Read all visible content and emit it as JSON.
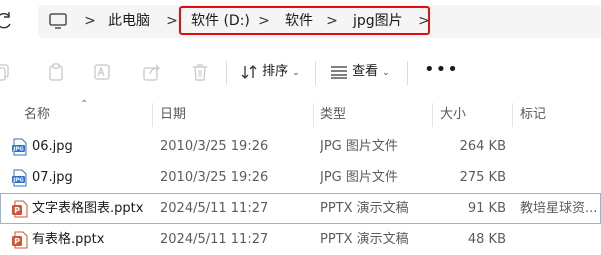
{
  "address_bar": {
    "crumbs": [
      "此电脑",
      "软件 (D:)",
      "软件",
      "jpg图片"
    ],
    "separator": ">"
  },
  "toolbar": {
    "sort_label": "排序",
    "view_label": "查看",
    "more_label": "•••"
  },
  "columns": {
    "name": "名称",
    "date": "日期",
    "type": "类型",
    "size": "大小",
    "tags": "标记"
  },
  "files": [
    {
      "name": "06.jpg",
      "date": "2010/3/25 19:26",
      "type": "JPG 图片文件",
      "size": "264 KB",
      "tags": "",
      "icon": "jpg-file-icon"
    },
    {
      "name": "07.jpg",
      "date": "2010/3/25 19:26",
      "type": "JPG 图片文件",
      "size": "275 KB",
      "tags": "",
      "icon": "jpg-file-icon"
    },
    {
      "name": "文字表格图表.pptx",
      "date": "2024/5/11 11:27",
      "type": "PPTX 演示文稿",
      "size": "91 KB",
      "tags": "教培星球资...",
      "icon": "pptx-file-icon"
    },
    {
      "name": "有表格.pptx",
      "date": "2024/5/11 11:27",
      "type": "PPTX 演示文稿",
      "size": "48 KB",
      "tags": "",
      "icon": "pptx-file-icon"
    }
  ],
  "colors": {
    "highlight_border": "#e01010",
    "selected_row_border": "#9ab4d6",
    "pptx_icon": "#d35230",
    "jpg_icon": "#2f6fc9"
  }
}
